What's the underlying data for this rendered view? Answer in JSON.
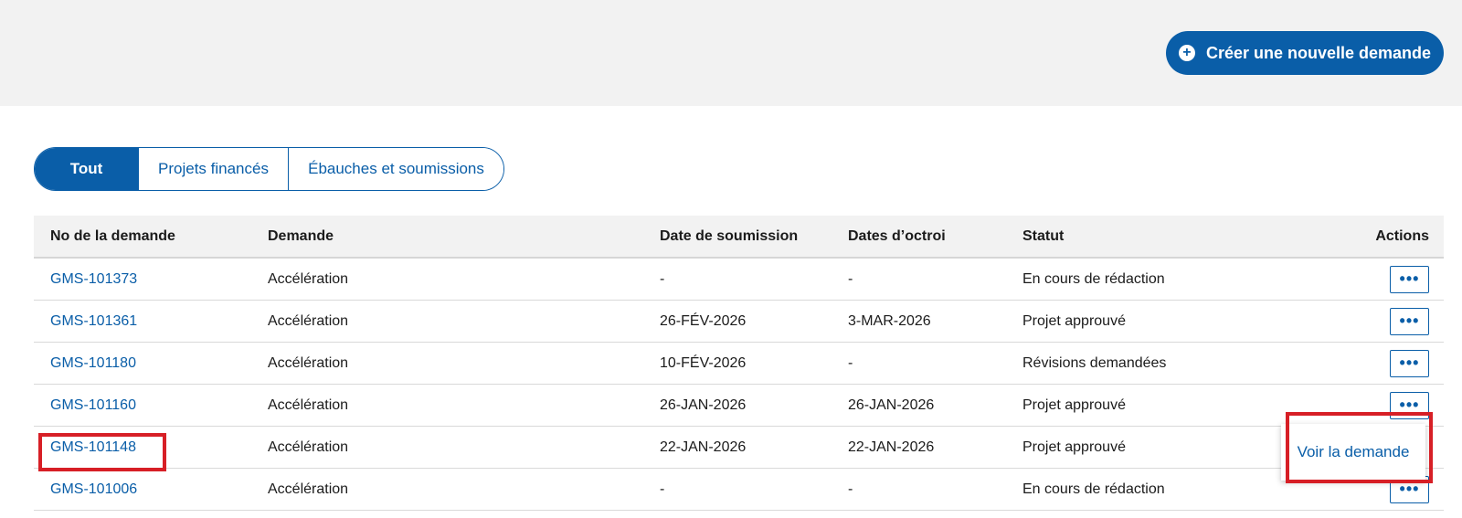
{
  "header": {
    "create_button_label": "Créer une nouvelle demande"
  },
  "tabs": [
    {
      "label": "Tout",
      "active": true
    },
    {
      "label": "Projets financés",
      "active": false
    },
    {
      "label": "Ébauches et soumissions",
      "active": false
    }
  ],
  "table": {
    "columns": [
      "No de la demande",
      "Demande",
      "Date de soumission",
      "Dates d’octroi",
      "Statut",
      "Actions"
    ],
    "rows": [
      {
        "id": "GMS-101373",
        "demande": "Accélération",
        "submitted": "-",
        "granted": "-",
        "status": "En cours de rédaction"
      },
      {
        "id": "GMS-101361",
        "demande": "Accélération",
        "submitted": "26-FÉV-2026",
        "granted": "3-MAR-2026",
        "status": "Projet approuvé"
      },
      {
        "id": "GMS-101180",
        "demande": "Accélération",
        "submitted": "10-FÉV-2026",
        "granted": "-",
        "status": "Révisions demandées"
      },
      {
        "id": "GMS-101160",
        "demande": "Accélération",
        "submitted": "26-JAN-2026",
        "granted": "26-JAN-2026",
        "status": "Projet approuvé"
      },
      {
        "id": "GMS-101148",
        "demande": "Accélération",
        "submitted": "22-JAN-2026",
        "granted": "22-JAN-2026",
        "status": "Projet approuvé"
      },
      {
        "id": "GMS-101006",
        "demande": "Accélération",
        "submitted": "-",
        "granted": "-",
        "status": "En cours de rédaction"
      }
    ],
    "more_button_glyph": "•••"
  },
  "popover": {
    "label": "Voir la demande"
  },
  "colors": {
    "primary": "#0a5ea8",
    "highlight": "#d71f26",
    "band": "#f2f2f2"
  },
  "icons": {
    "create": "plus-circle-icon",
    "more": "ellipsis-icon"
  }
}
